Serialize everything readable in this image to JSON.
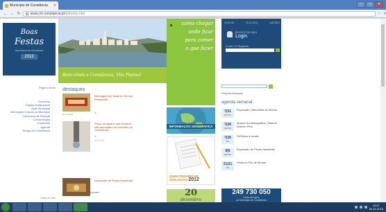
{
  "browser": {
    "tab_title": "Município de Constância",
    "url_host": "www.cm-constancia.pt",
    "url_path": "/pt/home.htm"
  },
  "left": {
    "logo": {
      "line1": "Boas",
      "line2": "Festas",
      "sub": "Vila Poema de Constância",
      "year": "2013"
    },
    "home_link": "Página Inicial",
    "menu": [
      "Concelho",
      "Órgãos Autárquicos",
      "Ação Municipal",
      "Informação e Apoio ao Munícipe",
      "Concursos de Pessoal",
      "Comunicação",
      "Contactos",
      "Agenda",
      "Tempo em Constância"
    ],
    "visits": "Visitas ao Site"
  },
  "hero": {
    "banner": "Bem-vindo a Constância, Vila Poema!"
  },
  "destaques": {
    "title": "destaques",
    "items": [
      {
        "date": "20.12.2013",
        "title": "Mensagem de Natal do Senhor Presidente",
        "meta": "",
        "extra": ""
      },
      {
        "date": "",
        "title": "Preço da água e dos resíduos não aumentam no concelho de Constância",
        "meta": "20.12.13",
        "extra": ""
      },
      {
        "date": "",
        "title": "Exposição de Peças Natalícias",
        "meta": "",
        "extra": "+ de 8 de dezembro a 6 de janeiro"
      }
    ]
  },
  "green_links": [
    "como chegar",
    "onde ficar",
    "para comer",
    "o que fazer"
  ],
  "banners": {
    "geo": "INFORMAÇÃO GEOGRÁFICA",
    "survey_title": "QUESTIONÁRIO DE AVALIAÇÃO",
    "survey_year": "2012",
    "date_day": "20",
    "date_month": "dezembro"
  },
  "login": {
    "top_left": "10:37:46",
    "top_mid": "20.12.2013",
    "top_right": "ACESSO",
    "small": "REGISTO DE AQUI",
    "label": "Login",
    "field_label": "E-mail / Nº Registado"
  },
  "search": {
    "advanced": "Pesquisa Avançada"
  },
  "agenda": {
    "title": "agenda semanal",
    "items": [
      {
        "days": "7|31",
        "month": "DEZ/JAN",
        "title": "Exposição | Memórias do Mundo"
      },
      {
        "days": "7|28",
        "month": "DEZ/DEZ",
        "title": "Mostra bio-bibliográfica | Manuel António Pina"
      },
      {
        "days": "7|28",
        "month": "DEZ",
        "title": "DVDteca à venda"
      },
      {
        "days": "8|6",
        "month": "DEZ/JAN",
        "title": "Exposição de Peças Natalícias"
      },
      {
        "days": "21|21",
        "month": "DEZ",
        "title": "Festa do Fim de Mundo"
      }
    ]
  },
  "phone": {
    "number": "249 730 050",
    "line1": "Linha de Apoio",
    "line2": "ao Município de Constância"
  },
  "taskbar": {
    "time": "13:07",
    "date": "20-12-2013"
  }
}
